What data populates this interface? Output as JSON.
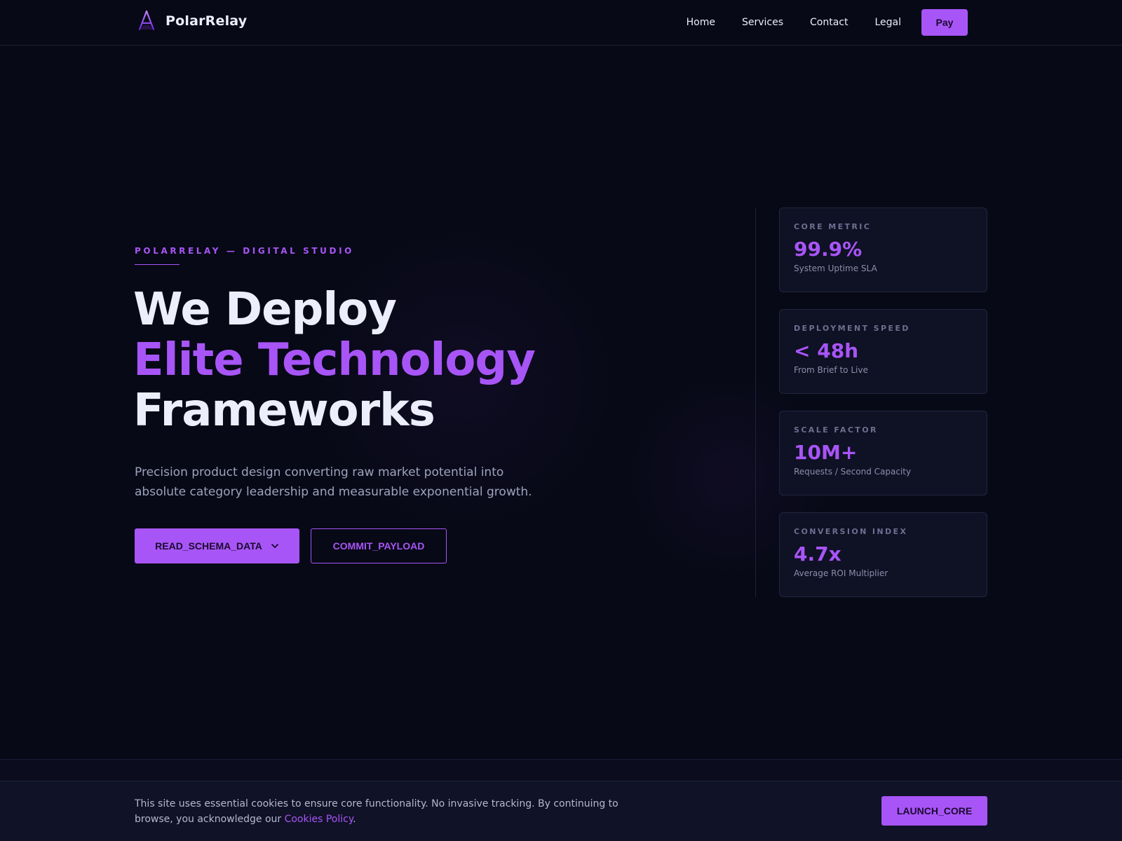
{
  "brand": {
    "name": "PolarRelay",
    "logo_icon": "triangle-a-logo-icon"
  },
  "nav": {
    "links": [
      "Home",
      "Services",
      "Contact",
      "Legal"
    ],
    "pay_label": "Pay"
  },
  "hero": {
    "eyebrow": "POLARRELAY — DIGITAL STUDIO",
    "headline_line1": "We Deploy",
    "headline_line2": "Elite Technology",
    "headline_line3": "Frameworks",
    "subtext": "Precision product design converting raw market potential into absolute category leadership and measurable exponential growth.",
    "primary_button": "READ_SCHEMA_DATA",
    "primary_button_icon": "chevron-down-icon",
    "secondary_button": "COMMIT_PAYLOAD"
  },
  "metrics": [
    {
      "label": "CORE METRIC",
      "value": "99.9%",
      "desc": "System Uptime SLA"
    },
    {
      "label": "DEPLOYMENT SPEED",
      "value": "< 48h",
      "desc": "From Brief to Live"
    },
    {
      "label": "SCALE FACTOR",
      "value": "10M+",
      "desc": "Requests / Second Capacity"
    },
    {
      "label": "CONVERSION INDEX",
      "value": "4.7x",
      "desc": "Average ROI Multiplier"
    }
  ],
  "cookie": {
    "text": "This site uses essential cookies to ensure core functionality. No invasive tracking. By continuing to browse, you acknowledge our ",
    "link": "Cookies Policy",
    "suffix": ".",
    "button": "LAUNCH_CORE"
  },
  "colors": {
    "background": "#070916",
    "accent": "#a855f7",
    "card": "#0f1124",
    "text": "#eceefb",
    "muted": "#9ea3bd"
  }
}
